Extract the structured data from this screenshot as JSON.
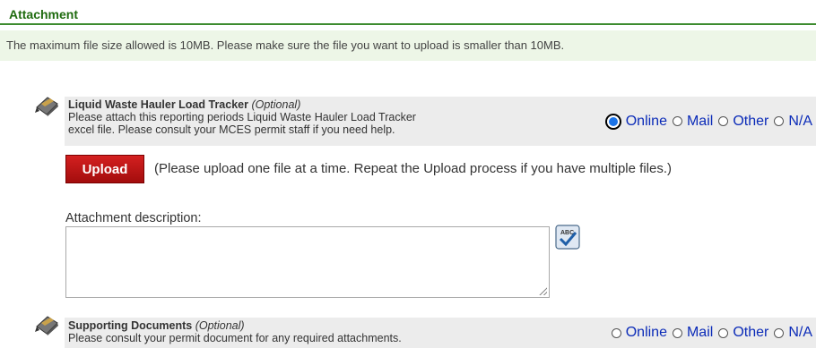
{
  "section": {
    "title": "Attachment"
  },
  "info": {
    "message": "The maximum file size allowed is 10MB. Please make sure the file you want to upload is smaller than 10MB."
  },
  "items": [
    {
      "title": "Liquid Waste Hauler Load Tracker",
      "optional": "(Optional)",
      "desc_line1": "Please attach this reporting periods Liquid Waste Hauler Load Tracker",
      "desc_line2": "excel file. Please consult your MCES permit staff if you need help.",
      "selected": "Online"
    },
    {
      "title": "Supporting Documents",
      "optional": "(Optional)",
      "desc_line1": "Please consult your permit document for any required attachments.",
      "selected": ""
    }
  ],
  "radio_options": [
    "Online",
    "Mail",
    "Other",
    "N/A"
  ],
  "upload": {
    "button_label": "Upload",
    "hint": "(Please upload one file at a time. Repeat the Upload process if you have multiple files.)"
  },
  "description": {
    "label": "Attachment description:",
    "value": ""
  },
  "icons": {
    "item": "pencil-icon",
    "spellcheck": "spellcheck-icon"
  }
}
